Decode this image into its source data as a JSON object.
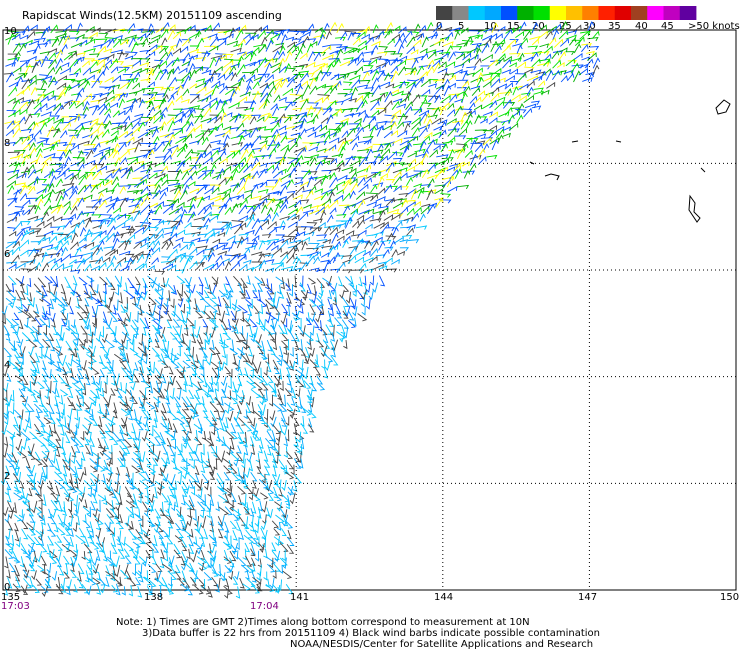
{
  "title": "Rapidscat Winds(12.5KM) 20151109 ascending",
  "legend": {
    "colors": [
      "#444444",
      "#888888",
      "#00c8ff",
      "#00a8ff",
      "#0050ff",
      "#00b000",
      "#00e000",
      "#ffff00",
      "#ffc000",
      "#ff8000",
      "#ff2000",
      "#e00000",
      "#a04020",
      "#ff00ff",
      "#c000c0",
      "#6000a0"
    ],
    "labels": [
      "0",
      "5",
      "10",
      "15",
      "20",
      "25",
      "30",
      "35",
      "40",
      "45",
      ">50 knots"
    ]
  },
  "axes": {
    "lat_labels": [
      "10",
      "8",
      "6",
      "4",
      "2",
      "0"
    ],
    "lon_labels": [
      "135",
      "138",
      "141",
      "144",
      "147",
      "150"
    ]
  },
  "times": {
    "left": "17:03",
    "mid": "17:04"
  },
  "notes": [
    "Note: 1) Times are GMT 2)Times along bottom correspond to measurement at 10N",
    "3)Data buffer is 22 hrs from 20151109 4) Black wind barbs indicate possible contamination",
    "NOAA/NESDIS/Center for Satellite Applications and Research"
  ],
  "map_data": {
    "lat_range": [
      0,
      10.5
    ],
    "lon_range": [
      135,
      150
    ],
    "swath_edge": [
      [
        9.5,
        146.3
      ],
      [
        8.0,
        144.8
      ],
      [
        6.8,
        143.5
      ],
      [
        4.0,
        141.5
      ],
      [
        2.0,
        141.0
      ],
      [
        0.0,
        140.8
      ]
    ],
    "speed_zones": [
      {
        "name": "north",
        "lat_min": 7.0,
        "color_ids": [
          4,
          5,
          6,
          7,
          4
        ]
      },
      {
        "name": "mid",
        "lat_min": 5.0,
        "color_ids": [
          4,
          3,
          2,
          0
        ]
      },
      {
        "name": "south",
        "lat_min": 0.0,
        "color_ids": [
          2,
          3,
          2,
          0
        ]
      }
    ],
    "grid": "on"
  }
}
